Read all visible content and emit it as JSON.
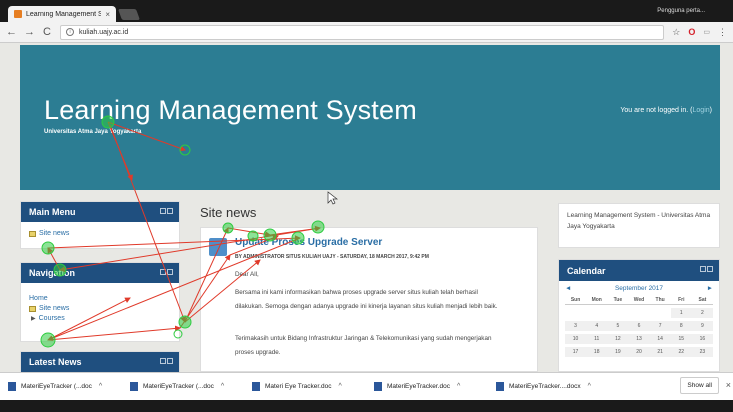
{
  "browser": {
    "tab_title": "Learning Management S",
    "tab_close": "×",
    "user_label": "Pengguna perta...",
    "url": "kuliah.uajy.ac.id",
    "back": "←",
    "forward": "→",
    "reload": "C",
    "star": "☆",
    "opera": "O",
    "menu": "⋮"
  },
  "banner": {
    "title": "Learning Management System",
    "subtitle": "Universitas Atma Jaya Yogyakarta",
    "login_text": "You are not logged in. (",
    "login_link": "Login",
    "login_end": ")"
  },
  "main_menu": {
    "title": "Main Menu",
    "items": [
      "Site news"
    ]
  },
  "navigation": {
    "title": "Navigation",
    "home": "Home",
    "site_news": "Site news",
    "courses": "Courses"
  },
  "latest_news": {
    "title": "Latest News"
  },
  "site_news": {
    "heading": "Site news",
    "post_title": "Update Proses Upgrade Server",
    "post_meta": "BY ADMINISTRATOR SITUS KULIAH UAJY - SATURDAY, 18 MARCH 2017, 9:42 PM",
    "greeting": "Dear All,",
    "para1_line1": "Bersama ini kami informasikan bahwa proses upgrade server situs kuliah telah berhasil",
    "para1_line2": "dilakukan. Semoga dengan adanya upgrade ini kinerja layanan situs kuliah menjadi lebih baik.",
    "para2_line1": "Terimakasih untuk Bidang Infrastruktur Jaringan & Telekomunikasi yang sudah mengerjakan",
    "para2_line2": "proses upgrade."
  },
  "about": {
    "text": "Learning Management System - Universitas Atma Jaya Yogyakarta"
  },
  "calendar": {
    "title": "Calendar",
    "month": "September 2017",
    "prev": "◄",
    "next": "►",
    "days": [
      "Sun",
      "Mon",
      "Tue",
      "Wed",
      "Thu",
      "Fri",
      "Sat"
    ],
    "cells": [
      "",
      "",
      "",
      "",
      "",
      "1",
      "2",
      "3",
      "4",
      "5",
      "6",
      "7",
      "8",
      "9",
      "10",
      "11",
      "12",
      "13",
      "14",
      "15",
      "16",
      "17",
      "18",
      "19",
      "20",
      "21",
      "22",
      "23"
    ]
  },
  "downloads": {
    "items": [
      "MateriEyeTracker (...doc",
      "MateriEyeTracker (...doc",
      "Materi Eye Tracker.doc",
      "MateriEyeTracker.doc",
      "MateriEyeTracker....docx"
    ],
    "caret": "^",
    "show_all": "Show all",
    "close": "×"
  },
  "colors": {
    "banner": "#2c7d93",
    "block_header": "#1f4f7f",
    "link": "#2a6ea5",
    "gaze_fixation": "#2ecc40",
    "gaze_saccade": "#e03a2a"
  }
}
